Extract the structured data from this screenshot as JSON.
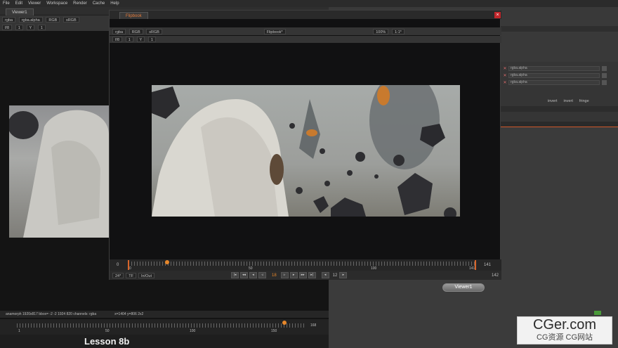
{
  "menu": [
    "File",
    "Edit",
    "Viewer",
    "Workspace",
    "Render",
    "Cache",
    "Help"
  ],
  "left_viewer": {
    "tab": "Viewer1",
    "channel_selects": [
      "rgba",
      "rgba.alpha",
      "RGB",
      "sRGB"
    ],
    "frame_controls": [
      "f/8",
      "1",
      "Y",
      "1"
    ],
    "status": "anamorph 1920x817  bbox= -2 -2 1924 820 channels: rgba",
    "coords": "x=1404 y=806 2x2",
    "timeline_marks": [
      "1",
      "50",
      "100",
      "150",
      "168"
    ],
    "lesson": "Lesson 8b"
  },
  "flipbook": {
    "tab": "Flipbook",
    "close": "×",
    "selects": [
      "rgba",
      "RGB",
      "sRGB"
    ],
    "flipbook_select": "Flipbook*",
    "zoom": "100%",
    "ratio": "1:1*",
    "frame_controls": [
      "f/8",
      "1",
      "Y",
      "1"
    ],
    "frame_start": "0",
    "frame_mid": "18",
    "frame_end": "141",
    "frame_last": "142",
    "timeline_marks": [
      "0",
      "50",
      "100",
      "141"
    ],
    "fps": "24*",
    "tf": "TF",
    "mode": "In/Out",
    "step": "12"
  },
  "properties": {
    "channel_rows": [
      "rgba.alpha",
      "rgba.alpha",
      "rgba.alpha"
    ],
    "buttons": [
      "invert",
      "invert",
      "fringe"
    ]
  },
  "node": {
    "label": "Viewer1"
  },
  "watermark": {
    "title": "CGer.com",
    "subtitle": "CG资源 CG网站"
  }
}
